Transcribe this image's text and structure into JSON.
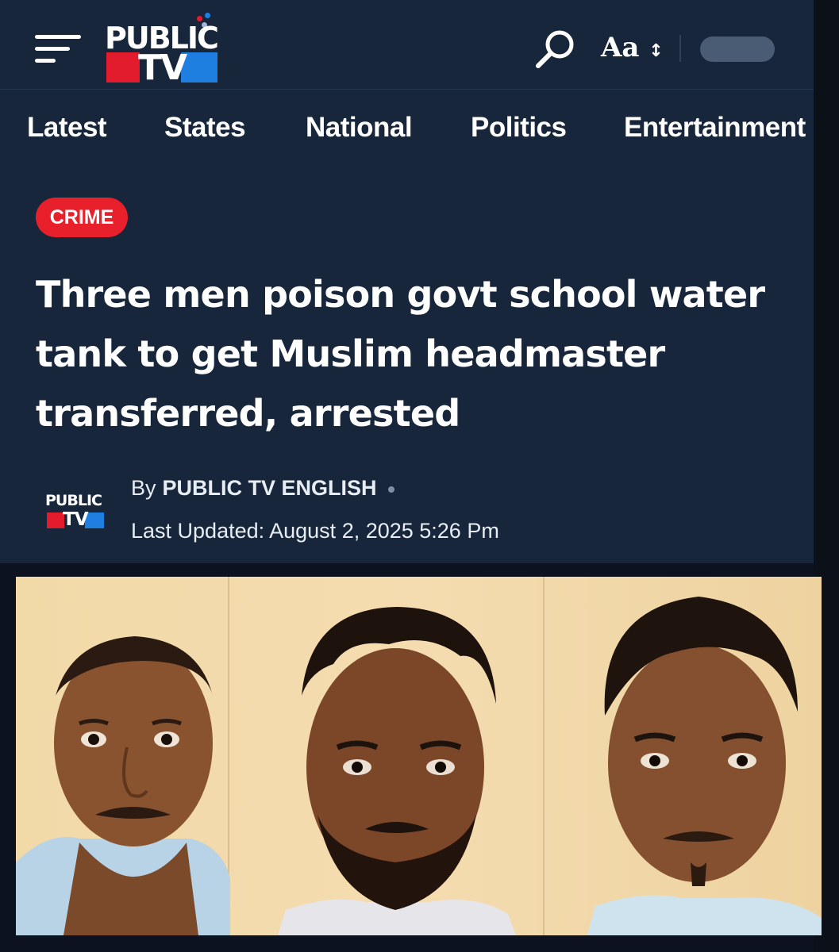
{
  "header": {
    "logo_text_top": "PUBLIC",
    "logo_text_bottom": "TV",
    "font_size_label": "Aa",
    "font_size_arrow": "↕"
  },
  "nav": {
    "items": [
      "Latest",
      "States",
      "National",
      "Politics",
      "Entertainment"
    ]
  },
  "article": {
    "category": "CRIME",
    "headline": "Three men poison govt school water tank to get Muslim headmaster transferred, arrested",
    "by_label": "By",
    "author": "PUBLIC TV ENGLISH",
    "updated": "Last Updated: August 2, 2025 5:26 Pm"
  },
  "colors": {
    "background": "#17263a",
    "badge": "#e8202b",
    "logo_red": "#e21b2d",
    "logo_blue": "#1f7fe0"
  },
  "icons": [
    "menu-icon",
    "search-icon",
    "font-size-icon",
    "theme-toggle"
  ]
}
